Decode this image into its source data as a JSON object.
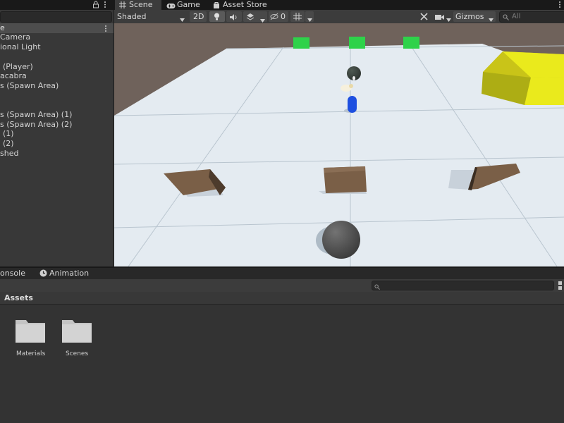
{
  "tabs": {
    "scene": "Scene",
    "game": "Game",
    "asset_store": "Asset Store"
  },
  "hierarchy": {
    "header": "e",
    "items": [
      "Camera",
      "ional Light",
      "(Player)",
      "acabra",
      "s (Spawn Area)",
      "s (Spawn Area) (1)",
      "s (Spawn Area) (2)",
      "(1)",
      "(2)",
      "shed"
    ]
  },
  "scene_toolbar": {
    "shading_mode": "Shaded",
    "mode_2d": "2D",
    "hidden_count": "0",
    "gizmos": "Gizmos",
    "search_placeholder": "All"
  },
  "bottom_tabs": {
    "console": "onsole",
    "animation": "Animation"
  },
  "project": {
    "assets_header": "Assets",
    "folders": [
      "Materials",
      "Scenes"
    ]
  },
  "colors": {
    "editor_bg": "#282828",
    "panel_bg": "#383838",
    "skybox": "#6f625b",
    "ground": "#e4ebf1",
    "grid_line": "#b8c4cf",
    "platform": "#7a5f47",
    "yellow_cube": "#eaea1c",
    "green_marker": "#2ed24a",
    "player": "#1d4fe0",
    "sphere": "#505050"
  }
}
